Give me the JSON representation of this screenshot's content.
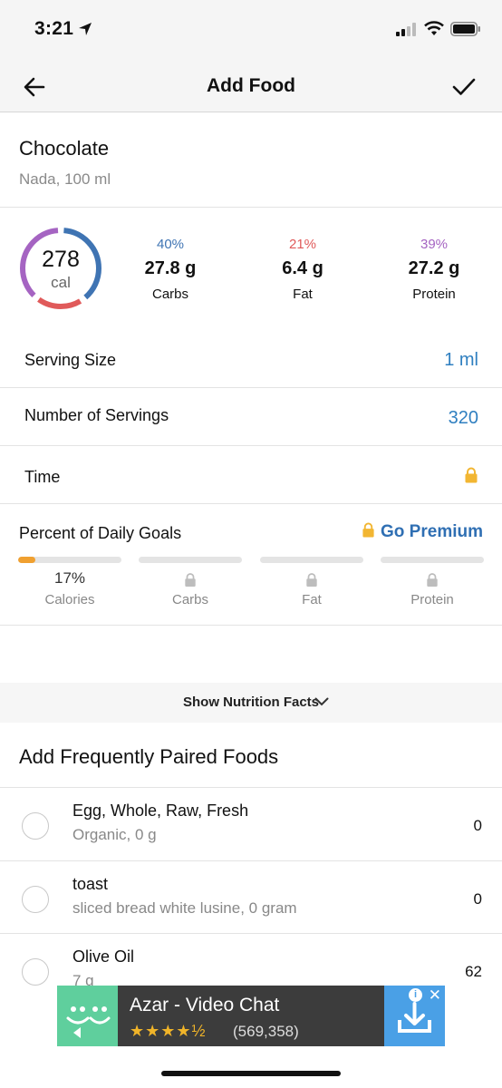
{
  "status_bar": {
    "time": "3:21"
  },
  "header": {
    "title": "Add Food"
  },
  "food": {
    "name": "Chocolate",
    "description": "Nada, 100 ml"
  },
  "summary": {
    "calories": "278",
    "calories_unit": "cal",
    "macros": [
      {
        "percent": "40%",
        "amount": "27.8 g",
        "label": "Carbs",
        "color": "#3f74b3"
      },
      {
        "percent": "21%",
        "amount": "6.4 g",
        "label": "Fat",
        "color": "#e05a5a"
      },
      {
        "percent": "39%",
        "amount": "27.2 g",
        "label": "Protein",
        "color": "#a564c2"
      }
    ]
  },
  "serving": {
    "size_label": "Serving Size",
    "size_value": "1 ml",
    "count_label": "Number of Servings",
    "count_value": "320",
    "time_label": "Time"
  },
  "goals": {
    "title": "Percent of Daily Goals",
    "premium_label": "Go Premium",
    "items": [
      {
        "value": "17%",
        "label": "Calories",
        "progress": 0.17,
        "locked": false
      },
      {
        "label": "Carbs",
        "locked": true
      },
      {
        "label": "Fat",
        "locked": true
      },
      {
        "label": "Protein",
        "locked": true
      }
    ]
  },
  "nutrition_facts": {
    "label": "Show Nutrition Facts"
  },
  "paired": {
    "title": "Add Frequently Paired Foods",
    "items": [
      {
        "name": "Egg, Whole, Raw, Fresh",
        "description": "Organic, 0 g",
        "calories": "0"
      },
      {
        "name": "toast",
        "description": "sliced bread white lusine, 0 gram",
        "calories": "0"
      },
      {
        "name": "Olive Oil",
        "description": "7 g",
        "calories": "62"
      }
    ]
  },
  "ad": {
    "title": "Azar - Video Chat",
    "stars": "★★★★½",
    "rating_count": "(569,358)"
  },
  "colors": {
    "accent_blue": "#2f7fc0",
    "lock_yellow": "#f2b632",
    "progress_orange": "#f0a030"
  }
}
